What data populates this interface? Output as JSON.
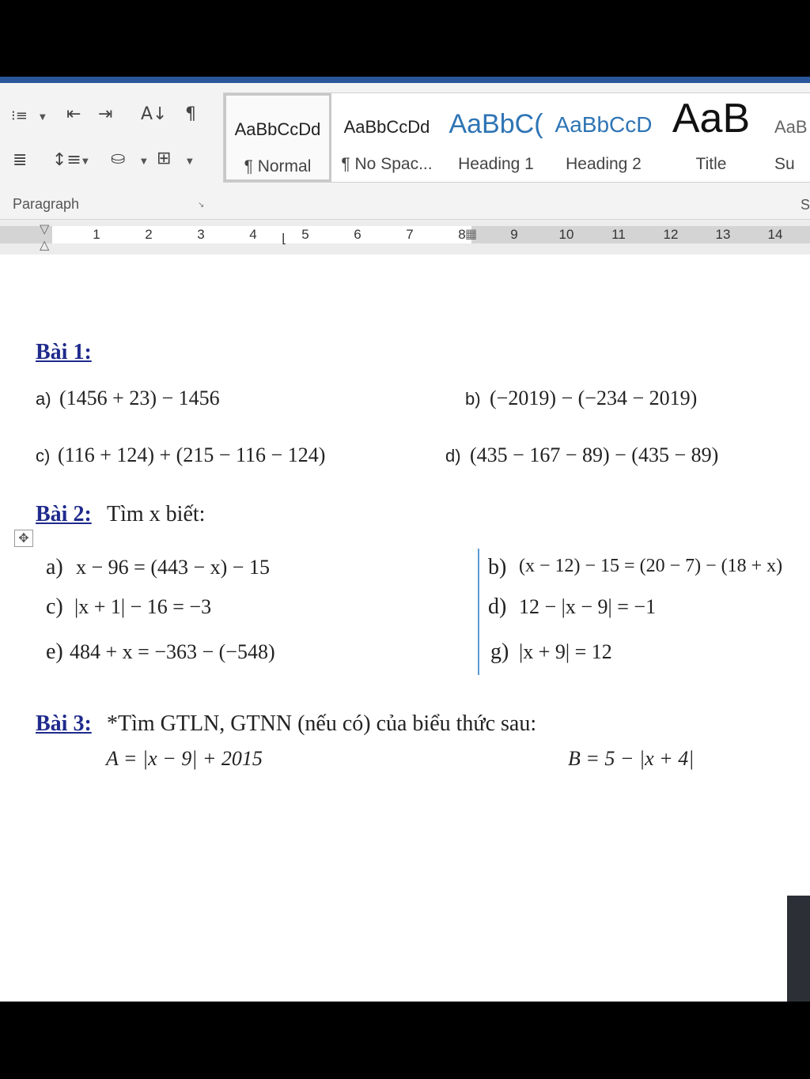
{
  "ribbon": {
    "paragraph_group_label": "Paragraph",
    "styles_group_label": "S",
    "styles": [
      {
        "preview": "AaBbCcDd",
        "name": "¶ Normal",
        "selected": true
      },
      {
        "preview": "AaBbCcDd",
        "name": "¶ No Spac...",
        "selected": false
      },
      {
        "preview": "AaBbC(",
        "name": "Heading 1",
        "selected": false
      },
      {
        "preview": "AaBbCcD",
        "name": "Heading 2",
        "selected": false
      },
      {
        "preview": "AaB",
        "name": "Title",
        "selected": false
      },
      {
        "preview": "AaB",
        "name": "Su",
        "selected": false
      }
    ],
    "icons": [
      "multilevel-list-icon",
      "decrease-indent-icon",
      "increase-indent-icon",
      "sort-icon",
      "pilcrow-icon",
      "justify-icon",
      "line-spacing-icon",
      "shading-icon",
      "borders-icon"
    ]
  },
  "ruler": {
    "numbers": [
      "1",
      "2",
      "3",
      "4",
      "5",
      "6",
      "7",
      "8",
      "9",
      "10",
      "11",
      "12",
      "13",
      "14"
    ]
  },
  "document": {
    "bai1": {
      "title": "Bài 1:",
      "items": [
        {
          "label": "a)",
          "expr": "(1456 + 23) − 1456"
        },
        {
          "label": "b)",
          "expr": "(−2019) − (−234 − 2019)"
        },
        {
          "label": "c)",
          "expr": "(116 + 124) + (215 − 116 − 124)"
        },
        {
          "label": "d)",
          "expr": "(435 − 167 − 89) − (435 − 89)"
        }
      ]
    },
    "bai2": {
      "title": "Bài 2:",
      "subtitle": "Tìm x biết:",
      "items": [
        {
          "label": "a)",
          "expr": "x − 96 = (443 − x) − 15"
        },
        {
          "label": "b)",
          "expr": "(x − 12) − 15 = (20 − 7) − (18 + x)"
        },
        {
          "label": "c)",
          "expr": "|x + 1| − 16 = −3"
        },
        {
          "label": "d)",
          "expr": "12 − |x − 9| = −1"
        },
        {
          "label": "e)",
          "expr": "484 + x = −363 − (−548)"
        },
        {
          "label": "g)",
          "expr": "|x + 9| = 12"
        }
      ]
    },
    "bai3": {
      "title": "Bài 3:",
      "subtitle": "*Tìm GTLN, GTNN (nếu có) của biểu thức sau:",
      "items": [
        {
          "expr": "A = |x − 9| + 2015"
        },
        {
          "expr": "B = 5 − |x + 4|"
        }
      ]
    }
  },
  "colors": {
    "heading": "#1f2a8c",
    "accent": "#2b579a",
    "table_border": "#5b9bd5"
  }
}
